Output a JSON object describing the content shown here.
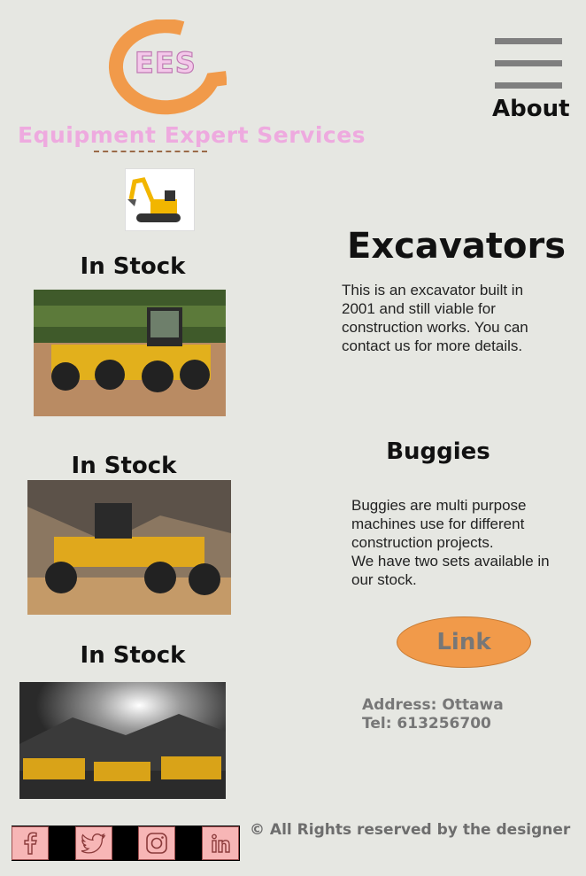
{
  "brand": {
    "logo_text": "EES",
    "name": "Equipment Expert Services"
  },
  "nav": {
    "about_label": "About"
  },
  "colors": {
    "accent": "#f19a4a",
    "brand_pink": "#eeaadf",
    "background": "#e6e7e2"
  },
  "stock": [
    {
      "label": "In Stock"
    },
    {
      "label": "In Stock"
    },
    {
      "label": "In Stock"
    }
  ],
  "excavators": {
    "title": "Excavators",
    "description": "This is an excavator built in 2001 and still viable for construction works. You can contact us for more details."
  },
  "buggies": {
    "title": "Buggies",
    "description_1": "Buggies are multi purpose machines use for different construction projects.",
    "description_2": "We have two sets available in our stock."
  },
  "link": {
    "label": "Link"
  },
  "contact": {
    "address": "Address: Ottawa",
    "tel": "Tel: 613256700"
  },
  "social": [
    {
      "icon": "facebook-icon"
    },
    {
      "icon": "twitter-icon"
    },
    {
      "icon": "instagram-icon"
    },
    {
      "icon": "linkedin-icon"
    }
  ],
  "footer": {
    "copyright": "© All Rights reserved by the designer"
  }
}
